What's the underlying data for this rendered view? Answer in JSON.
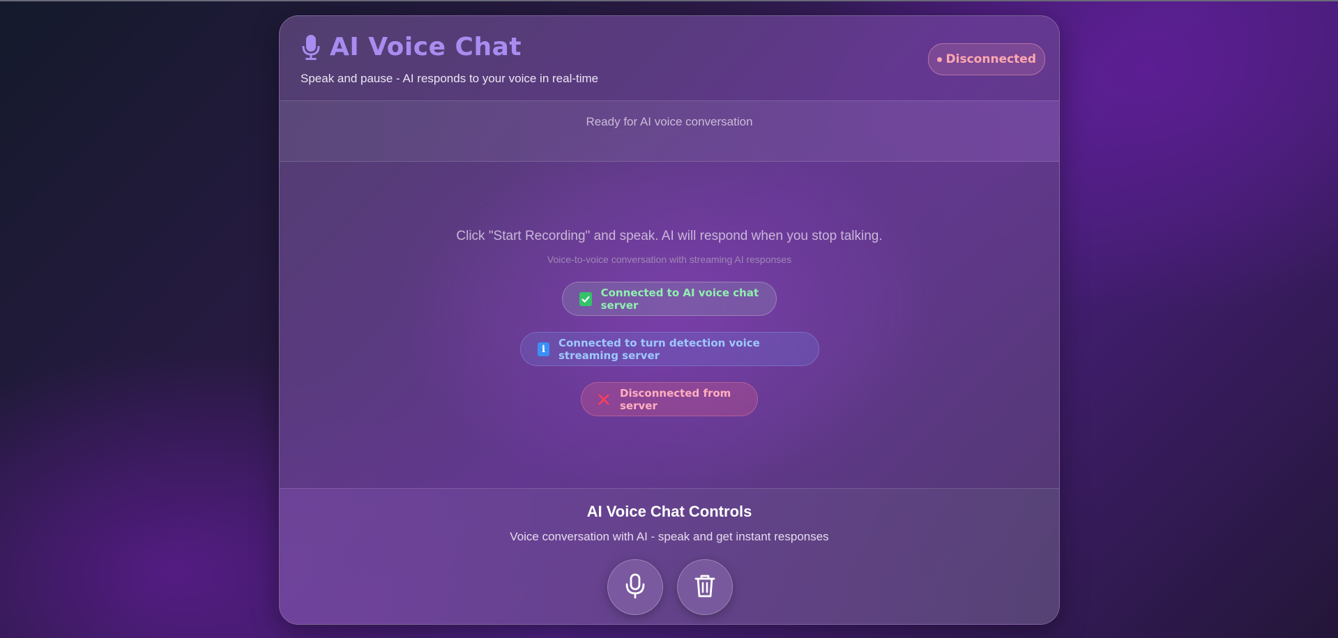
{
  "header": {
    "title": "AI Voice Chat",
    "subtitle": "Speak and pause - AI responds to your voice in real-time",
    "connection_status": "Disconnected"
  },
  "status_bar": {
    "text": "Ready for AI voice conversation"
  },
  "chat": {
    "hint": "Click \"Start Recording\" and speak. AI will respond when you stop talking.",
    "subhint": "Voice-to-voice conversation with streaming AI responses",
    "messages": [
      {
        "type": "success",
        "icon": "check-icon",
        "text": "Connected to AI voice chat server"
      },
      {
        "type": "info",
        "icon": "info-icon",
        "text": "Connected to turn detection voice streaming server"
      },
      {
        "type": "error",
        "icon": "x-icon",
        "text": "Disconnected from server"
      }
    ]
  },
  "controls": {
    "title": "AI Voice Chat Controls",
    "subtitle": "Voice conversation with AI - speak and get instant responses",
    "buttons": [
      {
        "icon": "microphone-icon"
      },
      {
        "icon": "trash-icon"
      }
    ]
  },
  "colors": {
    "accent": "#a98cf0",
    "success": "#8ff0b0",
    "info": "#9ec8ff",
    "error": "#ffb0c0",
    "disconnected": "#ffa8b0"
  }
}
